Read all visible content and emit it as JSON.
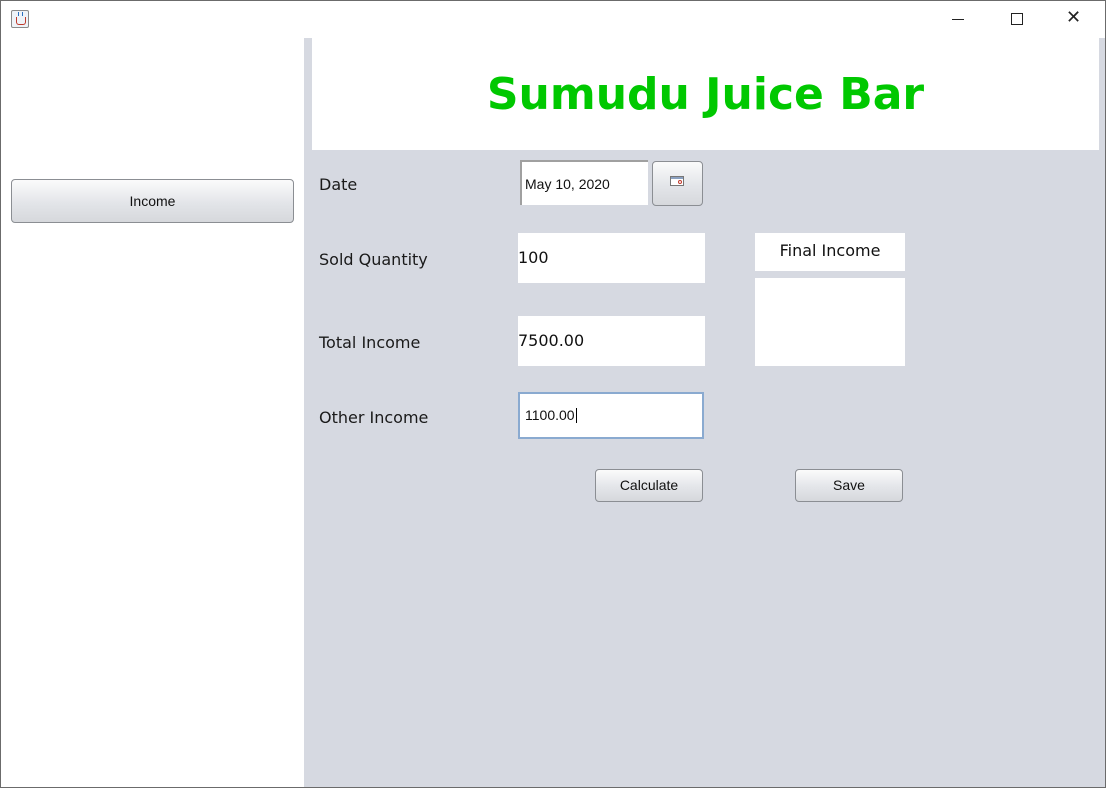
{
  "window": {
    "title": "",
    "controls": {
      "minimize_icon": "minimize-icon",
      "maximize_icon": "maximize-icon",
      "close_label": "✕"
    }
  },
  "sidebar": {
    "income_button_label": "Income"
  },
  "header": {
    "title": "Sumudu Juice Bar",
    "title_color": "#00c800"
  },
  "form": {
    "date_label": "Date",
    "date_value": "May 10, 2020",
    "date_picker_icon": "calendar-icon",
    "sold_quantity_label": "Sold Quantity",
    "sold_quantity_value": "100",
    "total_income_label": "Total Income",
    "total_income_value": "7500.00",
    "other_income_label": "Other Income",
    "other_income_value": "1100.00",
    "final_income_label": "Final Income",
    "final_income_value": ""
  },
  "actions": {
    "calculate_label": "Calculate",
    "save_label": "Save"
  },
  "colors": {
    "panel_background": "#d6d9e1",
    "focus_border": "#8aaad0"
  }
}
